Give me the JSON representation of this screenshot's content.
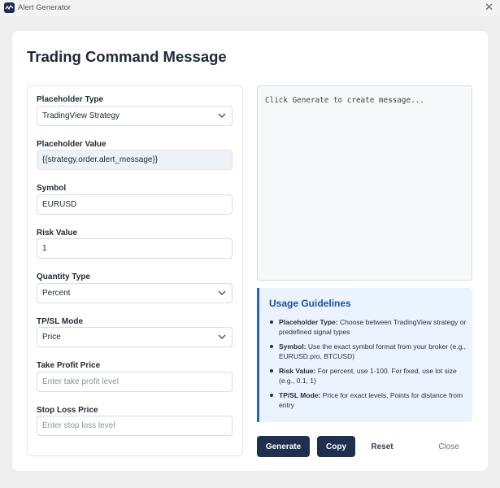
{
  "window": {
    "title": "Alert Generator",
    "close_glyph": "✕",
    "icon": "chart-logo-icon"
  },
  "page_title": "Trading Command Message",
  "form": {
    "placeholder_type": {
      "label": "Placeholder Type",
      "value": "TradingView Strategy"
    },
    "placeholder_value": {
      "label": "Placeholder Value",
      "value": "{{strategy.order.alert_message}}"
    },
    "symbol": {
      "label": "Symbol",
      "value": "EURUSD"
    },
    "risk_value": {
      "label": "Risk Value",
      "value": "1"
    },
    "quantity_type": {
      "label": "Quantity Type",
      "value": "Percent"
    },
    "tpsl_mode": {
      "label": "TP/SL Mode",
      "value": "Price"
    },
    "take_profit": {
      "label": "Take Profit Price",
      "placeholder": "Enter take profit level"
    },
    "stop_loss": {
      "label": "Stop Loss Price",
      "placeholder": "Enter stop loss level"
    }
  },
  "output": {
    "text": "Click Generate to create message..."
  },
  "guidelines": {
    "title": "Usage Guidelines",
    "items": [
      {
        "term": "Placeholder Type:",
        "text": " Choose between TradingView strategy or predefined signal types"
      },
      {
        "term": "Symbol:",
        "text": " Use the exact symbol format from your broker (e.g., EURUSD.pro, BTCUSD)"
      },
      {
        "term": "Risk Value:",
        "text": " For percent, use 1-100. For fixed, use lot size (e.g., 0.1, 1)"
      },
      {
        "term": "TP/SL Mode:",
        "text": " Price for exact levels, Points for distance from entry"
      }
    ]
  },
  "buttons": {
    "generate": "Generate",
    "copy": "Copy",
    "reset": "Reset",
    "close": "Close"
  },
  "colors": {
    "primary_button": "#1e2f4f",
    "guide_accent": "#2563c9",
    "guide_bg": "#eaf3ff",
    "guide_title": "#1e4fa3"
  }
}
